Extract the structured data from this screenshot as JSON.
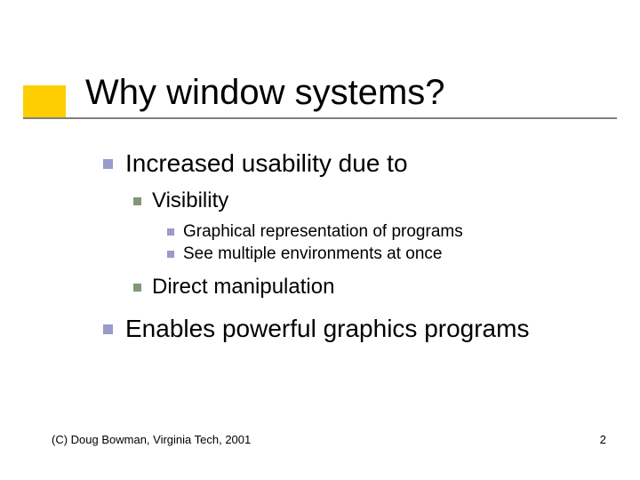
{
  "title": "Why window systems?",
  "bullets": {
    "l1a": "Increased usability due to",
    "l2a": "Visibility",
    "l3a": "Graphical representation of programs",
    "l3b": "See multiple environments at once",
    "l2b": "Direct manipulation",
    "l1b": "Enables powerful graphics programs"
  },
  "footer": {
    "copyright": "(C) Doug Bowman, Virginia Tech, 2001",
    "page": "2"
  }
}
